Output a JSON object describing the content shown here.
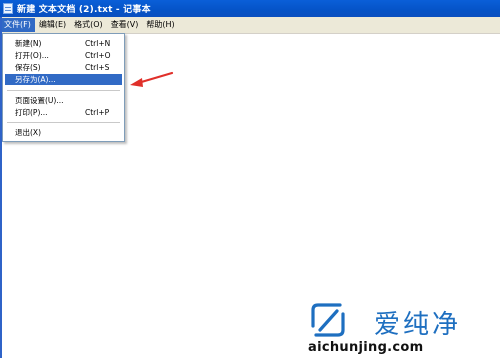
{
  "window": {
    "title": "新建 文本文档 (2).txt - 记事本",
    "icon": "notepad-icon"
  },
  "menubar": {
    "items": [
      "文件(F)",
      "编辑(E)",
      "格式(O)",
      "查看(V)",
      "帮助(H)"
    ],
    "active_index": 0
  },
  "file_menu": {
    "items": [
      {
        "label": "新建(N)",
        "shortcut": "Ctrl+N"
      },
      {
        "label": "打开(O)...",
        "shortcut": "Ctrl+O"
      },
      {
        "label": "保存(S)",
        "shortcut": "Ctrl+S"
      },
      {
        "label": "另存为(A)...",
        "shortcut": ""
      },
      {
        "label": "页面设置(U)...",
        "shortcut": ""
      },
      {
        "label": "打印(P)...",
        "shortcut": "Ctrl+P"
      },
      {
        "label": "退出(X)",
        "shortcut": ""
      }
    ],
    "selected_label": "另存为(A)..."
  },
  "annotation": {
    "arrow_color": "#e0302a",
    "points_to": "另存为(A)..."
  },
  "watermark": {
    "brand_cn": "爱纯净",
    "url": "aichunjing.com",
    "color": "#1e6fc0"
  },
  "colors": {
    "titlebar": "#0553c7",
    "menubar": "#ece9d8",
    "highlight": "#316ac5"
  }
}
